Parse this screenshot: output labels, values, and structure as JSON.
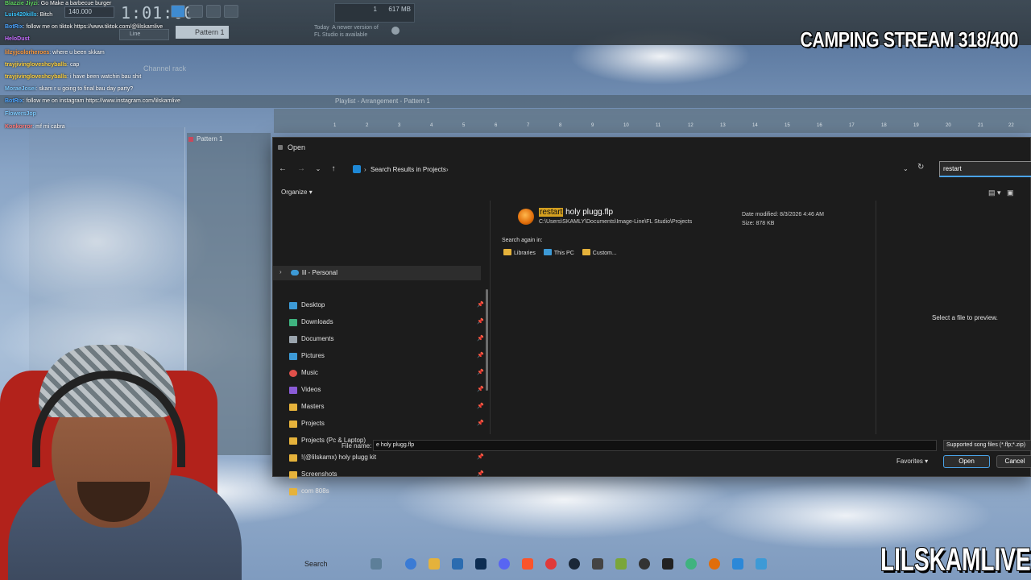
{
  "stream": {
    "title": "CAMPING STREAM 318/400",
    "watermark": "LILSKAMLIVE"
  },
  "fl": {
    "time": "1:01:00",
    "tempo": "140.000",
    "cpu_value": "1",
    "memory": "617 MB",
    "pattern": "Pattern 1",
    "line_mode": "Line",
    "hint": "Today  A newer version of\nFL Studio is available",
    "channel_rack": "Channel rack",
    "playlist_title": "Playlist - Arrangement - Pattern 1",
    "pattern_item": "Pattern 1",
    "ruler_numbers": [
      "1",
      "2",
      "3",
      "4",
      "5",
      "6",
      "7",
      "8",
      "9",
      "10",
      "11",
      "12",
      "13",
      "14",
      "15",
      "16",
      "17",
      "18",
      "19",
      "20",
      "21",
      "22"
    ]
  },
  "chat": [
    {
      "user": "Blazzie Jiyzi",
      "msg": "Go Make a barbecue burger",
      "color": "#5fd35f"
    },
    {
      "user": "Luis420kills",
      "msg": "Bitch",
      "color": "#39c6ff"
    },
    {
      "user": "BotRix",
      "msg": "follow me on tiktok https://www.tiktok.com/@lilskamlive",
      "color": "#4aa3ff"
    },
    {
      "user": "HeloDust",
      "msg": "",
      "color": "#c66cff"
    },
    {
      "user": "lilzyjcolorheroes",
      "msg": "where u been skkam",
      "color": "#ff9b3d"
    },
    {
      "user": "trayjivingloveshcyballs",
      "msg": "cap",
      "color": "#ffd23d"
    },
    {
      "user": "trayjivingloveshcyballs",
      "msg": "i have been watchin bau shit",
      "color": "#ffd23d"
    },
    {
      "user": "MoraeJosei",
      "msg": "skam r u going to final bau day party?",
      "color": "#7ecbff"
    },
    {
      "user": "BotRix",
      "msg": "follow me on instagram https://www.instagram.com/lilskamlive",
      "color": "#4aa3ff"
    },
    {
      "user": "FlowersJop",
      "msg": "",
      "color": "#7ecbff"
    },
    {
      "user": "Konkorror",
      "msg": "mf mi cabra",
      "color": "#ff7b7b"
    }
  ],
  "dialog": {
    "title": "Open",
    "breadcrumb": [
      "Search Results in Projects"
    ],
    "search_value": "restart",
    "organize": "Organize",
    "nav": {
      "onedrive": "lil - Personal",
      "items": [
        {
          "label": "Desktop",
          "icon": "desktop-icon",
          "color": "#3d9ad6"
        },
        {
          "label": "Downloads",
          "icon": "download-icon",
          "color": "#3fb37f"
        },
        {
          "label": "Documents",
          "icon": "document-icon",
          "color": "#9aa4ad"
        },
        {
          "label": "Pictures",
          "icon": "picture-icon",
          "color": "#3d9ad6"
        },
        {
          "label": "Music",
          "icon": "music-icon",
          "color": "#e0504a"
        },
        {
          "label": "Videos",
          "icon": "video-icon",
          "color": "#8a5bd6"
        },
        {
          "label": "Masters",
          "icon": "folder-icon",
          "color": "#e5b23b"
        },
        {
          "label": "Projects",
          "icon": "folder-icon",
          "color": "#e5b23b"
        },
        {
          "label": "Projects (Pc & Laptop)",
          "icon": "folder-icon",
          "color": "#e5b23b"
        },
        {
          "label": "!(@lilskamx) holy plugg kit",
          "icon": "folder-icon",
          "color": "#e5b23b"
        },
        {
          "label": "Screenshots",
          "icon": "folder-icon",
          "color": "#e5b23b"
        },
        {
          "label": "com 808s",
          "icon": "folder-icon",
          "color": "#e5b23b"
        }
      ]
    },
    "result": {
      "name_highlight": "restart",
      "name_rest": " holy plugg.flp",
      "path": "C:\\Users\\SKAMLY\\Documents\\Image-Line\\FL Studio\\Projects",
      "date_modified": "Date modified: 8/3/2026 4:46 AM",
      "size": "Size: 878 KB"
    },
    "search_again": "Search again in:",
    "search_again_links": [
      "Libraries",
      "This PC",
      "Custom..."
    ],
    "preview": "Select a file to preview.",
    "file_name_label": "File name:",
    "file_name_value": "e holy plugg.flp",
    "file_type": "Supported song files (*.flp;*.zip)",
    "favorites": "Favorites",
    "open": "Open",
    "cancel": "Cancel"
  },
  "taskbar": {
    "search": "Search"
  }
}
